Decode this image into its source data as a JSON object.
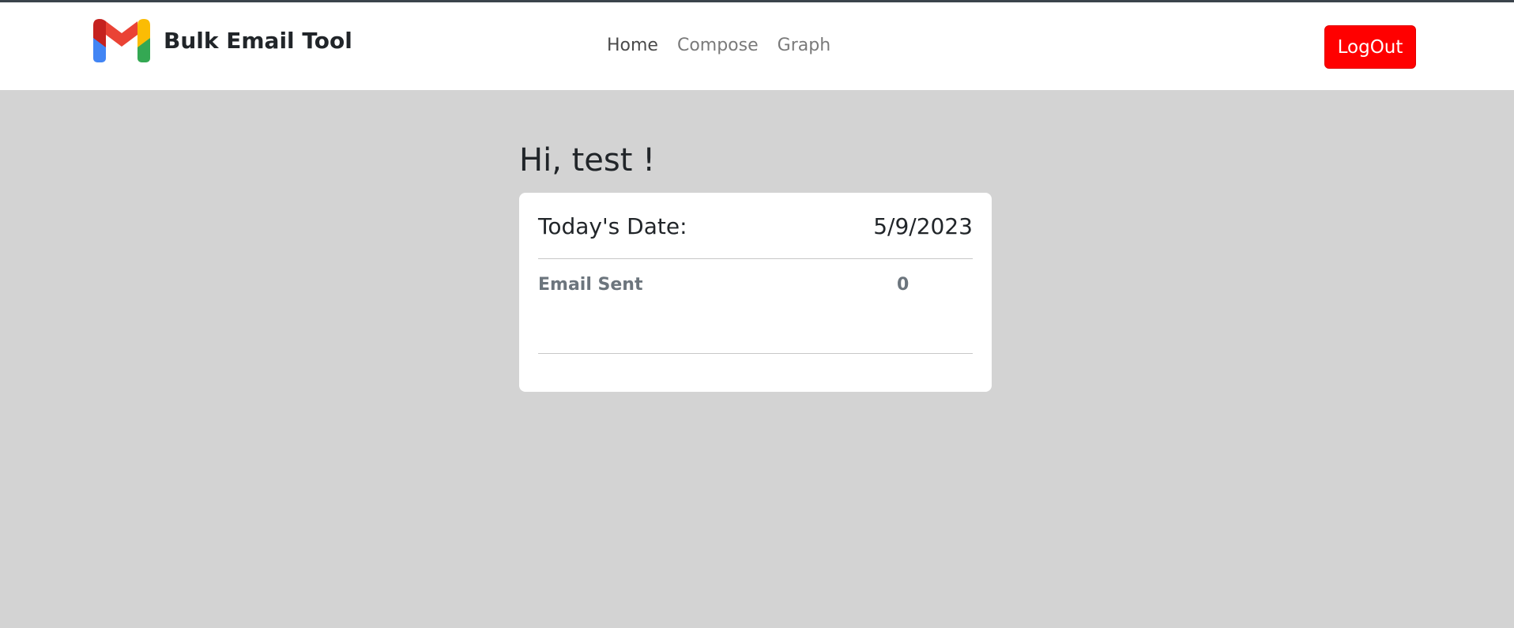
{
  "app": {
    "name": "Bulk Email Tool",
    "logo_icon": "gmail-logo-icon"
  },
  "nav": {
    "items": [
      {
        "label": "Home",
        "active": true
      },
      {
        "label": "Compose",
        "active": false
      },
      {
        "label": "Graph",
        "active": false
      }
    ],
    "logout_label": "LogOut",
    "logout_color": "#ff0000"
  },
  "main": {
    "greeting": "Hi, test !",
    "card": {
      "date_label": "Today's Date:",
      "date_value": "5/9/2023",
      "stat_label": "Email Sent",
      "stat_value": "0"
    }
  },
  "colors": {
    "page_background": "#d3d3d3",
    "card_background": "#ffffff",
    "logo_blue": "#4285f4",
    "logo_green": "#34a853",
    "logo_yellow": "#fbbc04",
    "logo_red": "#ea4335",
    "logo_dark_red": "#c5221f"
  }
}
